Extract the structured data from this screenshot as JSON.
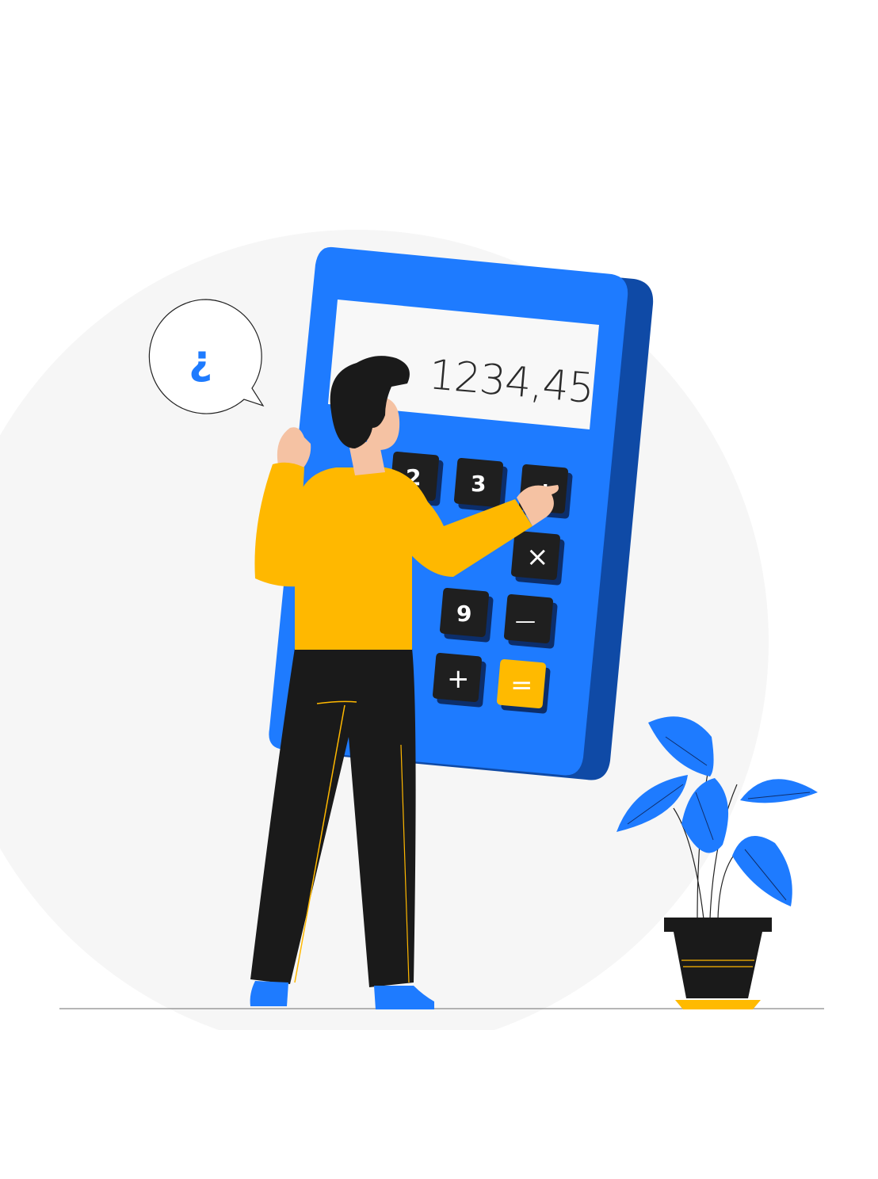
{
  "calculator": {
    "display_value": "1234,45",
    "keys": {
      "k2": "2",
      "k3": "3",
      "k9": "9",
      "divide": "÷",
      "multiply": "×",
      "minus": "—",
      "plus": "+",
      "equals": "="
    }
  },
  "speech_bubble": {
    "symbol": "¿"
  },
  "colors": {
    "calculator_blue": "#1e7bff",
    "calculator_side": "#0f4aa6",
    "shirt_yellow": "#ffb800",
    "pants_black": "#1a1a1a",
    "key_black": "#1f1f1f",
    "key_equals": "#ffba00",
    "plant_blue": "#1e7bff",
    "backdrop": "#f6f6f6"
  },
  "icons": {
    "speech_bubble": "speech-bubble-icon",
    "plant": "potted-plant-icon"
  }
}
